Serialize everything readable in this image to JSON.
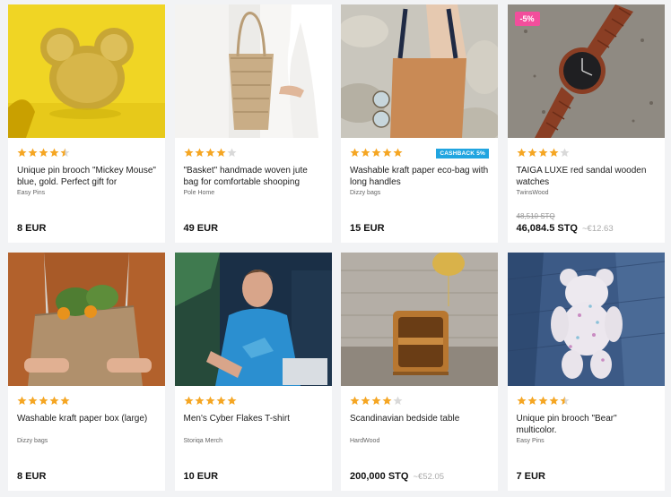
{
  "products": [
    {
      "title": "Unique pin brooch \"Mickey Mouse\" blue, gold. Perfect gift for",
      "seller": "Easy Pins",
      "price": "8 EUR",
      "rating": 4.5,
      "image": "gold-mickey-brooch"
    },
    {
      "title": "\"Basket\" handmade woven jute bag for comfortable shooping",
      "seller": "Pole Home",
      "price": "49 EUR",
      "rating": 4,
      "image": "jute-basket-bag"
    },
    {
      "title": "Washable kraft paper eco-bag with long handles",
      "seller": "Dizzy bags",
      "price": "15 EUR",
      "rating": 5,
      "badge": "CASHBACK 5%",
      "image": "kraft-eco-bag"
    },
    {
      "title": "TAIGA LUXE red sandal wooden watches",
      "seller": "TwinsWood",
      "price": "46,084.5 STQ",
      "old_price": "48,510 STQ",
      "approx": "~€12.63",
      "rating": 4,
      "discount": "-5%",
      "image": "wooden-watch"
    },
    {
      "title": "Washable kraft paper box (large)",
      "seller": "Dizzy bags",
      "price": "8 EUR",
      "rating": 5,
      "image": "kraft-paper-box"
    },
    {
      "title": "Men's Cyber Flakes T-shirt",
      "seller": "Storiqa Merch",
      "price": "10 EUR",
      "rating": 5,
      "image": "man-blue-tshirt"
    },
    {
      "title": "Scandinavian bedside table",
      "seller": "HardWood",
      "price": "200,000 STQ",
      "approx": "~€52.05",
      "rating": 4,
      "image": "wooden-bedside-table"
    },
    {
      "title": "Unique pin brooch \"Bear\" multicolor.",
      "seller": "Easy Pins",
      "price": "7 EUR",
      "rating": 4.5,
      "image": "bear-brooch"
    }
  ],
  "colors": {
    "star": "#f5a623",
    "star_empty": "#d9d9d9",
    "cashback": "#21a5e0",
    "discount": "#f24e9c"
  }
}
